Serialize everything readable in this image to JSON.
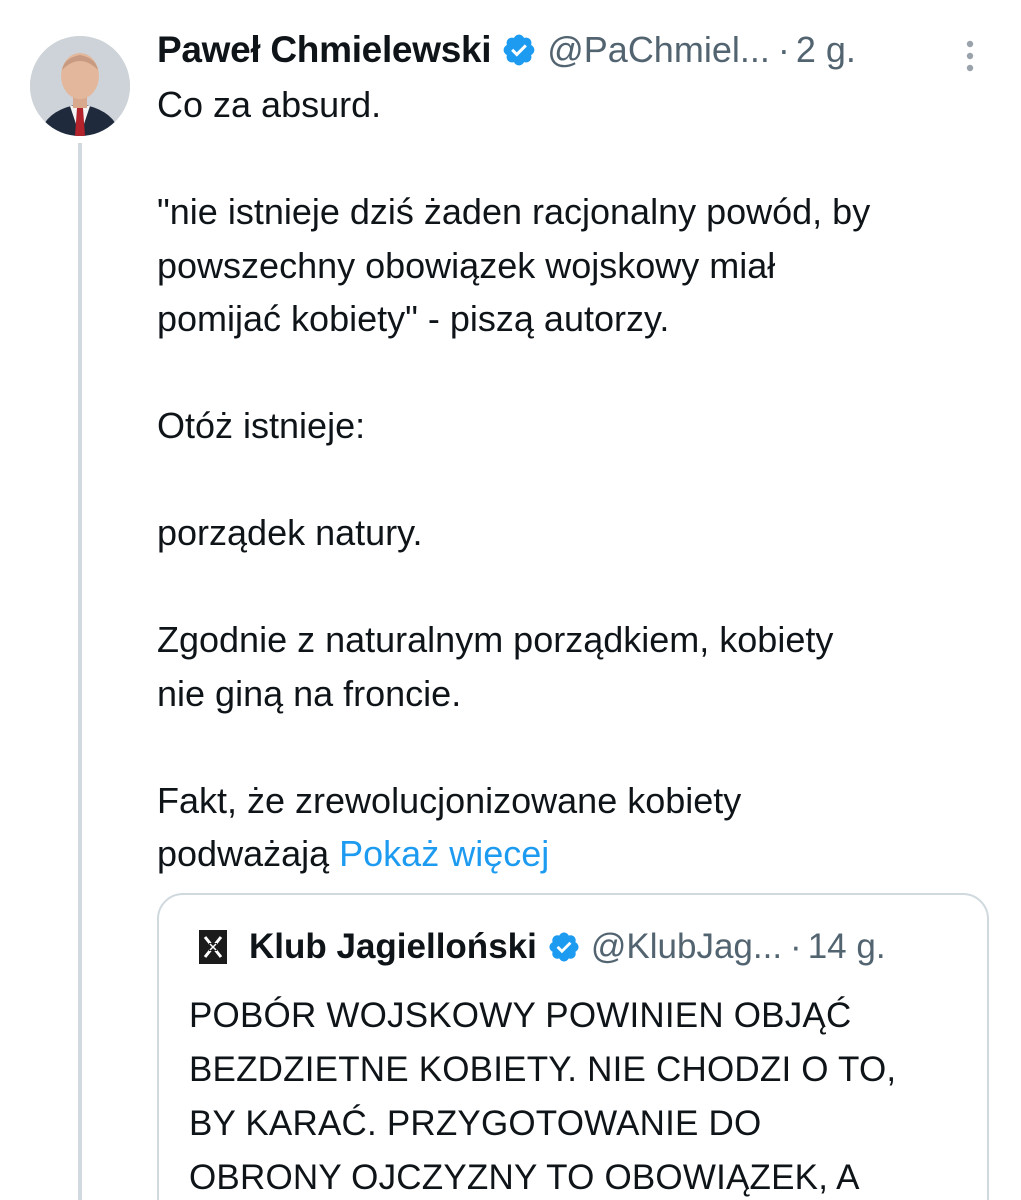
{
  "tweet": {
    "author_name": "Paweł Chmielewski",
    "handle": "@PaChmiel...",
    "separator": "·",
    "time": "2 g.",
    "paragraphs": [
      [
        "Co za absurd."
      ],
      [
        "\"nie istnieje dziś żaden racjonalny powód, by",
        "powszechny obowiązek wojskowy miał",
        "pomijać kobiety\" - piszą autorzy."
      ],
      [
        "Otóż istnieje:"
      ],
      [
        "porządek natury."
      ],
      [
        "Zgodnie z naturalnym porządkiem, kobiety",
        "nie giną na froncie."
      ]
    ],
    "last_line_1": "Fakt, że zrewolucjonizowane kobiety",
    "last_line_2": "podważają",
    "show_more": "Pokaż więcej"
  },
  "quoted_tweet": {
    "author_name": "Klub Jagielloński",
    "handle": "@KlubJag...",
    "separator": "·",
    "time": "14 g.",
    "lines": [
      "POBÓR WOJSKOWY POWINIEN OBJĄĆ",
      "BEZDZIETNE KOBIETY. NIE CHODZI O TO,",
      "BY KARAĆ. PRZYGOTOWANIE DO",
      "OBRONY OJCZYZNY TO OBOWIĄZEK, A"
    ]
  },
  "icons": {
    "verified": "verified-badge-icon",
    "more": "more-options-icon",
    "quoted_logo": "klub-jagiellonski-logo-icon"
  },
  "colors": {
    "link": "#1d9bf0",
    "secondary_text": "#536471",
    "verified": "#1d9bf0",
    "border": "#cfd9de"
  }
}
